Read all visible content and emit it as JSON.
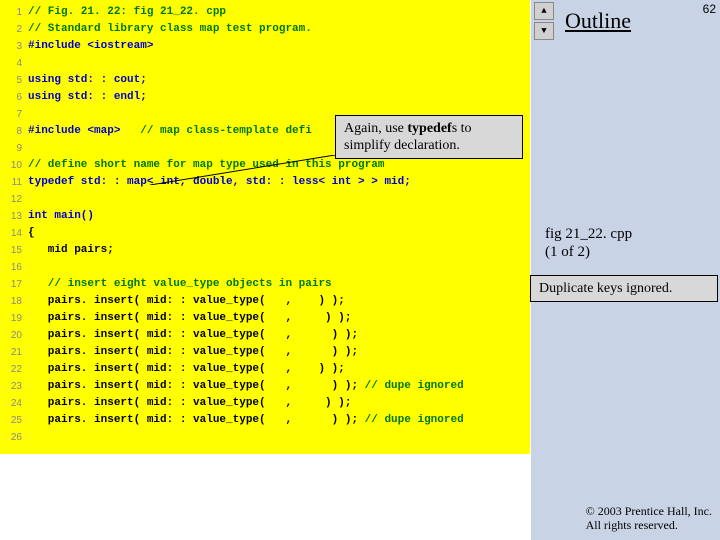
{
  "page_number": "62",
  "outline_title": "Outline",
  "fig_label_line1": "fig 21_22. cpp",
  "fig_label_line2": "(1 of 2)",
  "callout1_html": "Again, use <b>typedef</b>s to simplify declaration.",
  "callout2": "Duplicate keys ignored.",
  "copyright_line1": "© 2003 Prentice Hall, Inc.",
  "copyright_line2": "All rights reserved.",
  "nav_up": "▲",
  "nav_down": "▼",
  "code_lines": [
    {
      "n": "1",
      "spans": [
        {
          "c": "green",
          "t": "// Fig. 21. 22: fig 21_22. cpp"
        }
      ]
    },
    {
      "n": "2",
      "spans": [
        {
          "c": "green",
          "t": "// Standard library class map test program."
        }
      ]
    },
    {
      "n": "3",
      "spans": [
        {
          "c": "blue",
          "t": "#include <iostream>"
        }
      ]
    },
    {
      "n": "4",
      "spans": []
    },
    {
      "n": "5",
      "spans": [
        {
          "c": "blue",
          "t": "using std: : cout;"
        }
      ]
    },
    {
      "n": "6",
      "spans": [
        {
          "c": "blue",
          "t": "using std: : endl;"
        }
      ]
    },
    {
      "n": "7",
      "spans": []
    },
    {
      "n": "8",
      "spans": [
        {
          "c": "blue",
          "t": "#include <map>"
        },
        {
          "c": "green",
          "t": "   // map class-template defi"
        }
      ]
    },
    {
      "n": "9",
      "spans": []
    },
    {
      "n": "10",
      "spans": [
        {
          "c": "green",
          "t": "// define short name for map type used in this program"
        }
      ]
    },
    {
      "n": "11",
      "spans": [
        {
          "c": "blue",
          "t": "typedef std: : map< int, double, std: : less< int > > mid;"
        }
      ]
    },
    {
      "n": "12",
      "spans": []
    },
    {
      "n": "13",
      "spans": [
        {
          "c": "blue",
          "t": "int main()"
        }
      ]
    },
    {
      "n": "14",
      "spans": [
        {
          "c": "black",
          "t": "{"
        }
      ]
    },
    {
      "n": "15",
      "spans": [
        {
          "c": "black",
          "t": "   mid pairs;"
        }
      ]
    },
    {
      "n": "16",
      "spans": []
    },
    {
      "n": "17",
      "spans": [
        {
          "c": "green",
          "t": "   // insert eight value_type objects in pairs"
        }
      ]
    },
    {
      "n": "18",
      "spans": [
        {
          "c": "black",
          "t": "   pairs. insert( mid: : value_type(   ,    ) );"
        }
      ]
    },
    {
      "n": "19",
      "spans": [
        {
          "c": "black",
          "t": "   pairs. insert( mid: : value_type(   ,     ) );"
        }
      ]
    },
    {
      "n": "20",
      "spans": [
        {
          "c": "black",
          "t": "   pairs. insert( mid: : value_type(   ,      ) );"
        }
      ]
    },
    {
      "n": "21",
      "spans": [
        {
          "c": "black",
          "t": "   pairs. insert( mid: : value_type(   ,      ) );"
        }
      ]
    },
    {
      "n": "22",
      "spans": [
        {
          "c": "black",
          "t": "   pairs. insert( mid: : value_type(   ,    ) );"
        }
      ]
    },
    {
      "n": "23",
      "spans": [
        {
          "c": "black",
          "t": "   pairs. insert( mid: : value_type(   ,      ) ); "
        },
        {
          "c": "green",
          "t": "// dupe ignored"
        }
      ]
    },
    {
      "n": "24",
      "spans": [
        {
          "c": "black",
          "t": "   pairs. insert( mid: : value_type(   ,     ) );"
        }
      ]
    },
    {
      "n": "25",
      "spans": [
        {
          "c": "black",
          "t": "   pairs. insert( mid: : value_type(   ,      ) ); "
        },
        {
          "c": "green",
          "t": "// dupe ignored"
        }
      ]
    },
    {
      "n": "26",
      "spans": []
    }
  ]
}
